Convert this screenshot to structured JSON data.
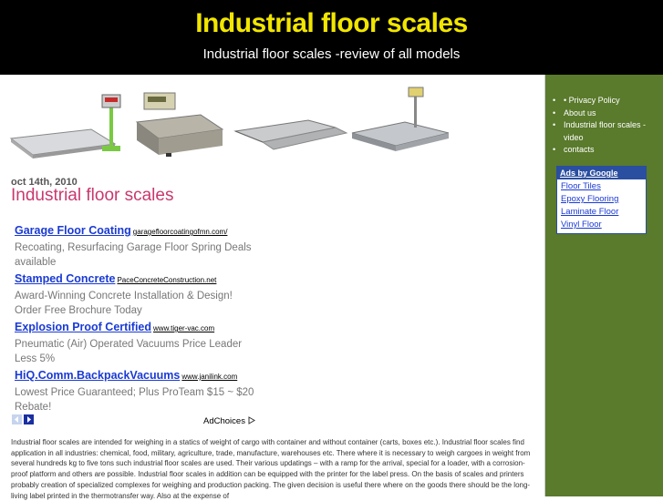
{
  "header": {
    "title": "Industrial floor scales",
    "subtitle": "Industrial floor scales -review of all models"
  },
  "post": {
    "date": "oct 14th, 2010",
    "title": "Industrial floor scales"
  },
  "ads": [
    {
      "title": "Garage Floor Coating",
      "url": "garagefloorcoatingofmn.com/",
      "desc": "Recoating, Resurfacing Garage Floor Spring Deals available"
    },
    {
      "title": "Stamped Concrete",
      "url": "PaceConcreteConstruction.net",
      "desc": "Award-Winning Concrete Installation & Design! Order Free Brochure Today"
    },
    {
      "title": "Explosion Proof Certified",
      "url": "www.tiger-vac.com",
      "desc": "Pneumatic (Air) Operated Vacuums Price Leader Less 5%"
    },
    {
      "title": "HiQ.Comm.BackpackVacuums",
      "url": "www.janilink.com",
      "desc": "Lowest Price Guaranteed; Plus ProTeam $15 ~ $20 Rebate!"
    }
  ],
  "adchoices_label": "AdChoices",
  "body_text": "Industrial floor scales are intended for weighing in a statics of weight of cargo with container and without container (carts, boxes etc.). Industrial floor scales find application in all industries: chemical, food, military, agriculture, trade, manufacture, warehouses etc. There where it is necessary to weigh cargoes in weight from several hundreds kg to five tons such industrial floor scales are used. Their various updatings – with a ramp for the arrival, special for a loader, with a corrosion-proof platform and others are possible. Industrial floor scales in addition can be equipped with the printer for the label press. On the basis of scales and printers probably creation of specialized complexes for weighing and production packing. The given decision is useful there where on the goods there should be the long-living label printed in the thermotransfer way. Also at the expense of",
  "sidebar": {
    "menu": [
      "• Privacy Policy",
      "About us",
      "Industrial floor scales -video",
      "contacts"
    ],
    "ads_header": "Ads by Google",
    "ads_links": [
      "Floor Tiles",
      "Epoxy Flooring",
      "Laminate Floor",
      "Vinyl Floor"
    ]
  },
  "colors": {
    "header_bg": "#000000",
    "title": "#f2e600",
    "post_title": "#c8386e",
    "sidebar_bg": "#5a7a2c",
    "ad_link": "#1a3ad4"
  }
}
